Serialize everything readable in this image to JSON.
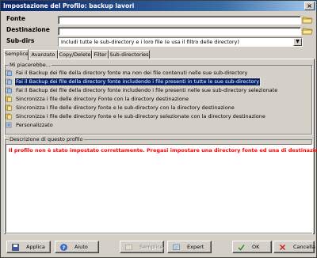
{
  "window": {
    "title": "Impostazione del Profilo: backup lavori",
    "close_label": "×"
  },
  "form": {
    "fonte_label": "Fonte",
    "destinazione_label": "Destinazione",
    "subdirs_label": "Sub-dirs",
    "fonte_value": "",
    "destinazione_value": "",
    "subdirs_value": "Includi tutte le sub-directory e i loro file (e usa il filtro delle directory)"
  },
  "tabs": [
    "Semplice",
    "Avanzato",
    "Copy/Delete",
    "Filter",
    "Sub-directories"
  ],
  "options": {
    "caption": "Mi piacerebbe...",
    "items": [
      "Fai il Backup dei file della directory fonte ma non dei file contenuti nelle sue sub-directory",
      "Fai il Backup dei file della directory fonte includendo i file presenti in tutte le sue sub-directory",
      "Fai il Backup dei file della directory fonte includendo i file presenti nelle sue sub-directory selezionate",
      "Sincronizza i file delle directory Fonte con la directory destinazione",
      "Sincronizza i file delle directory fonte e le sub-directory con la directory destinazione",
      "Sincronizza i file delle directory fonte e le sub-directory selezionate con la directory destinazione",
      "Personalizzato"
    ],
    "selected_index": 1
  },
  "description": {
    "caption": "Descrizione di questo profilo",
    "text": "Il profilo non è stato impostato correttamente. Pregasi impostare una directory fonte ed una di destinazione."
  },
  "buttons": {
    "applica": "Applica",
    "aiuto": "Aiuto",
    "semplice": "Semplice",
    "expert": "Expert",
    "ok": "OK",
    "cancella": "Cancella"
  },
  "colors": {
    "selection": "#0a246a",
    "error_text": "#ff0000",
    "titlebar": "#0a246a"
  }
}
